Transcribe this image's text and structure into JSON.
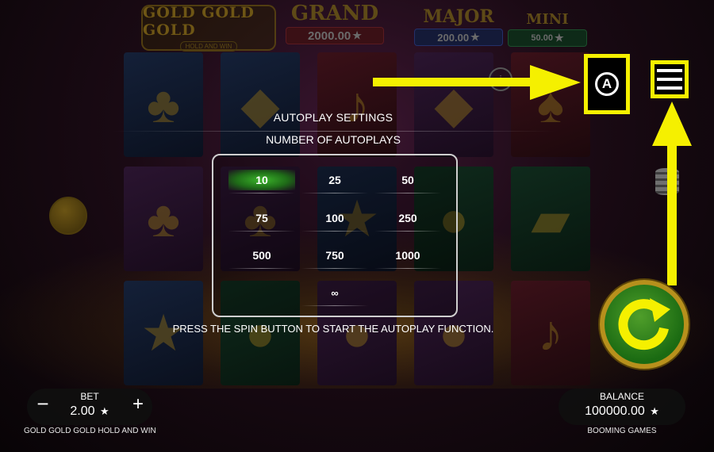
{
  "jackpots": {
    "grand": {
      "label": "GRAND",
      "value": "2000.00",
      "star": "★"
    },
    "major": {
      "label": "MAJOR",
      "value": "200.00",
      "star": "★"
    },
    "mini": {
      "label": "MINI",
      "value": "50.00",
      "star": "★"
    }
  },
  "logo": {
    "title": "GOLD GOLD GOLD",
    "subtitle": "HOLD AND WIN"
  },
  "autoplay": {
    "title": "AUTOPLAY SETTINGS",
    "subtitle": "NUMBER OF AUTOPLAYS",
    "options": [
      "10",
      "25",
      "50",
      "75",
      "100",
      "250",
      "500",
      "750",
      "1000",
      "∞"
    ],
    "selected": "10",
    "hint": "PRESS THE SPIN BUTTON TO START THE AUTOPLAY FUNCTION."
  },
  "controls": {
    "autoplay_icon_letter": "A",
    "highlight_color": "#f5f000"
  },
  "bet": {
    "label": "BET",
    "value": "2.00",
    "star": "★",
    "minus": "−",
    "plus": "+"
  },
  "balance": {
    "label": "BALANCE",
    "value": "100000.00",
    "star": "★"
  },
  "footer": {
    "game_name": "GOLD GOLD GOLD HOLD AND WIN",
    "provider": "BOOMING GAMES"
  },
  "colors": {
    "selected_option": "#2f9a24",
    "spin_button": "#2a8a1a",
    "spin_rim": "#b7901c",
    "spin_arrow": "#f5f000"
  },
  "icons": [
    "autoplay-icon",
    "menu-icon",
    "spin-icon",
    "arrow-right-icon",
    "arrow-up-icon"
  ]
}
